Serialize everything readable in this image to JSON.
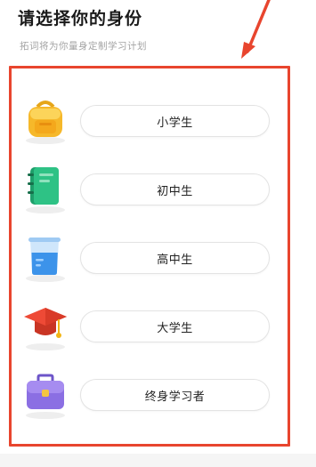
{
  "header": {
    "title": "请选择你的身份",
    "subtitle": "拓词将为你量身定制学习计划"
  },
  "options": [
    {
      "label": "小学生",
      "icon": "backpack-icon"
    },
    {
      "label": "初中生",
      "icon": "notebook-icon"
    },
    {
      "label": "高中生",
      "icon": "beaker-icon"
    },
    {
      "label": "大学生",
      "icon": "graduation-cap-icon"
    },
    {
      "label": "终身学习者",
      "icon": "briefcase-icon"
    }
  ],
  "colors": {
    "annotation": "#e8452e",
    "pill_border": "#e3e3e3",
    "title": "#1a1a1a",
    "subtitle": "#a3a3a3"
  }
}
